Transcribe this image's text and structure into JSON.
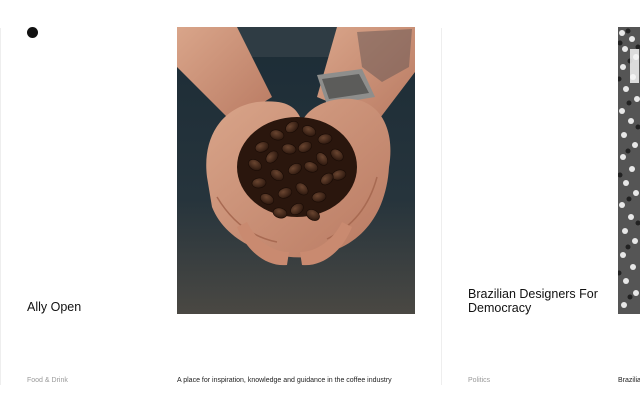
{
  "cards": [
    {
      "title": "Ally Open",
      "category": "Food & Drink",
      "description": "A place for inspiration, knowledge and guidance in the coffee industry"
    },
    {
      "title_line1": "Brazilian Designers For",
      "title_line2": "Democracy",
      "category": "Politics",
      "description": "Brazilia"
    }
  ],
  "colors": {
    "background": "#ffffff",
    "text": "#111111",
    "category": "#9a9a9a",
    "divider": "#eeeeee"
  },
  "icons": {
    "logo": "filled-circle-dot"
  }
}
